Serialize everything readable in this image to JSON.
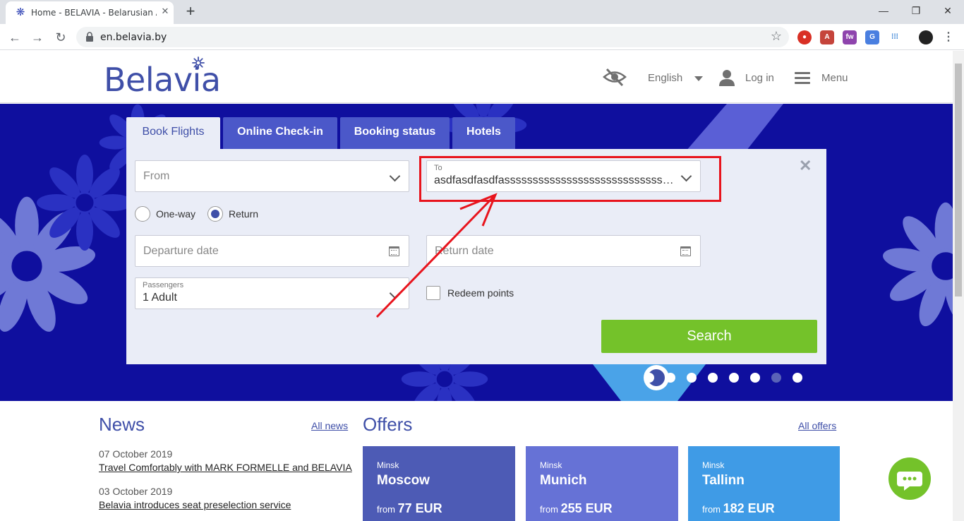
{
  "browser": {
    "tab_title": "Home - BELAVIA - Belarusian Airl",
    "url": "en.belavia.by",
    "new_tab": "+",
    "close_tab": "✕"
  },
  "header": {
    "logo": "Belavia",
    "language": "English",
    "login": "Log in",
    "menu": "Menu"
  },
  "booking": {
    "tabs": [
      "Book Flights",
      "Online Check-in",
      "Booking status",
      "Hotels"
    ],
    "from_placeholder": "From",
    "to_label": "To",
    "to_value": "asdfasdfasdfassssssssssssssssssssssssssssssssssssss",
    "trip_types": [
      "One-way",
      "Return"
    ],
    "selected_trip": "Return",
    "departure_placeholder": "Departure date",
    "return_placeholder": "Return date",
    "passengers_label": "Passengers",
    "passengers_value": "1 Adult",
    "redeem_label": "Redeem points",
    "search_label": "Search",
    "close": "✕"
  },
  "slider": {
    "total": 8,
    "active_index": 6
  },
  "news": {
    "title": "News",
    "all_link": "All news",
    "items": [
      {
        "date": "07 October 2019",
        "headline": "Travel Comfortably with MARK FORMELLE and BELAVIA"
      },
      {
        "date": "03 October 2019",
        "headline": "Belavia introduces seat preselection service"
      }
    ]
  },
  "offers": {
    "title": "Offers",
    "all_link": "All offers",
    "items": [
      {
        "from": "Minsk",
        "to": "Moscow",
        "price_prefix": "from",
        "price": "77 EUR",
        "color": "#4d5bb5"
      },
      {
        "from": "Minsk",
        "to": "Munich",
        "price_prefix": "from",
        "price": "255 EUR",
        "color": "#6672d6"
      },
      {
        "from": "Minsk",
        "to": "Tallinn",
        "price_prefix": "from",
        "price": "182 EUR",
        "color": "#3f9be6"
      }
    ]
  },
  "colors": {
    "brand": "#3f4fa8",
    "hero": "#0f0f9e",
    "search": "#74c22a",
    "annotation": "#e8141d"
  }
}
